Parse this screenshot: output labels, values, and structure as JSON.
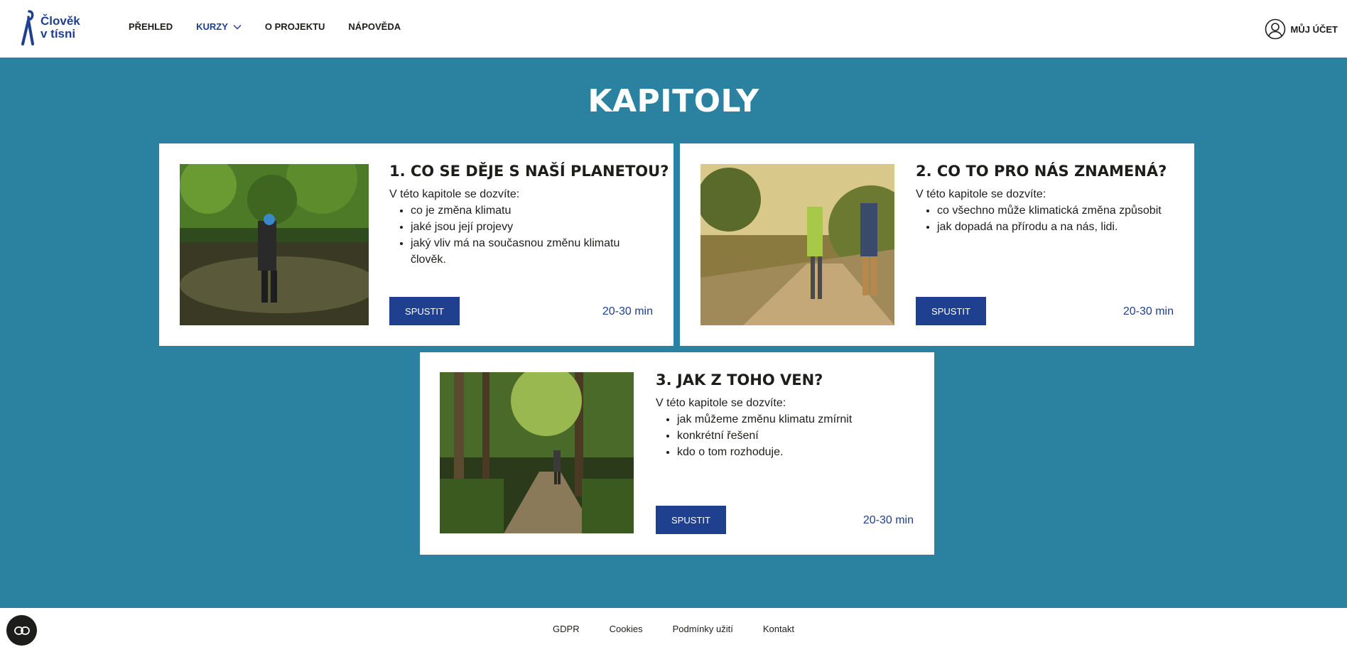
{
  "header": {
    "logo_line1": "Člověk",
    "logo_line2": "v tísni",
    "nav": [
      {
        "label": "PŘEHLED"
      },
      {
        "label": "KURZY"
      },
      {
        "label": "O PROJEKTU"
      },
      {
        "label": "NÁPOVĚDA"
      }
    ],
    "account_label": "MŮJ ÚČET"
  },
  "main": {
    "title": "KAPITOLY",
    "chapters": [
      {
        "title": "1. CO SE DĚJE S NAŠÍ PLANETOU?",
        "intro": "V této kapitole se dozvíte:",
        "bullets": [
          "co je změna klimatu",
          "jaké jsou její projevy",
          "jaký vliv má na současnou změnu klimatu člověk."
        ],
        "button": "SPUSTIT",
        "duration": "20-30 min"
      },
      {
        "title": "2. CO TO PRO NÁS ZNAMENÁ?",
        "intro": "V této kapitole se dozvíte:",
        "bullets": [
          "co všechno může klimatická změna způsobit",
          "jak dopadá na přírodu a na nás, lidi."
        ],
        "button": "SPUSTIT",
        "duration": "20-30 min"
      },
      {
        "title": "3. JAK Z TOHO VEN?",
        "intro": "V této kapitole se dozvíte:",
        "bullets": [
          "jak můžeme změnu klimatu zmírnit",
          "konkrétní řešení",
          "kdo o tom rozhoduje."
        ],
        "button": "SPUSTIT",
        "duration": "20-30 min"
      }
    ]
  },
  "footer": {
    "links": [
      "GDPR",
      "Cookies",
      "Podmínky užití",
      "Kontakt"
    ]
  },
  "colors": {
    "brand_blue": "#1f3f8f",
    "teal_background": "#2a82a0"
  }
}
